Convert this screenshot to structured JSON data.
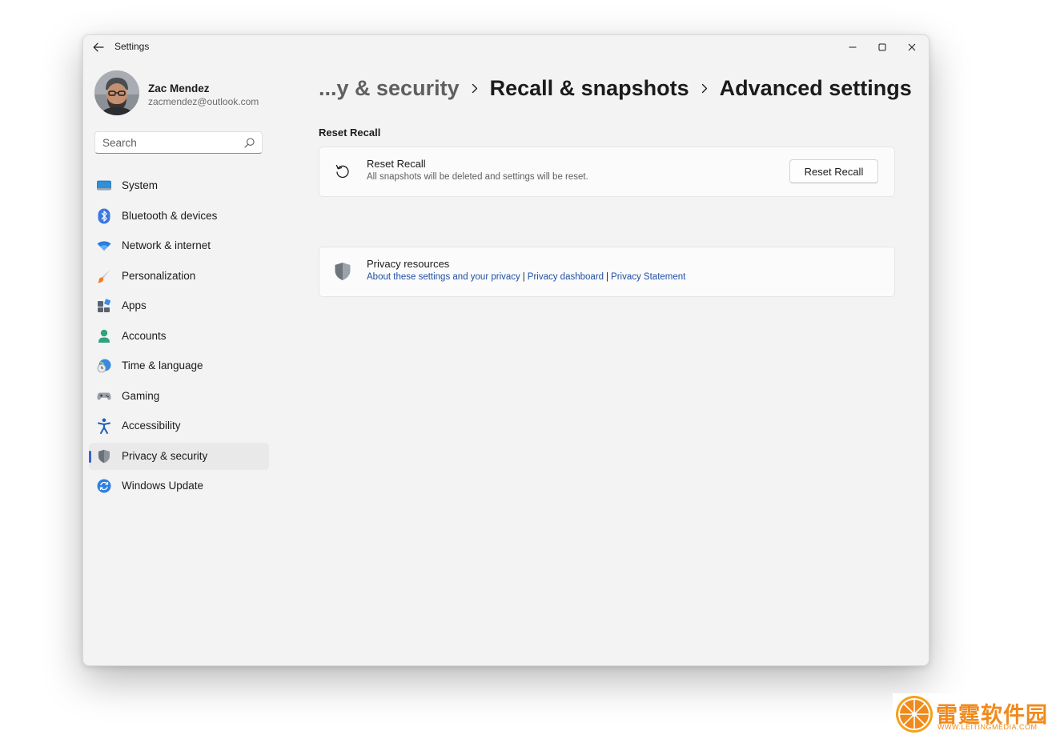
{
  "window": {
    "title": "Settings"
  },
  "profile": {
    "name": "Zac Mendez",
    "email": "zacmendez@outlook.com"
  },
  "search": {
    "placeholder": "Search"
  },
  "sidebar": {
    "items": [
      {
        "label": "System",
        "icon": "system-icon"
      },
      {
        "label": "Bluetooth & devices",
        "icon": "bluetooth-icon"
      },
      {
        "label": "Network & internet",
        "icon": "wifi-icon"
      },
      {
        "label": "Personalization",
        "icon": "brush-icon"
      },
      {
        "label": "Apps",
        "icon": "apps-icon"
      },
      {
        "label": "Accounts",
        "icon": "accounts-icon"
      },
      {
        "label": "Time & language",
        "icon": "globe-clock-icon"
      },
      {
        "label": "Gaming",
        "icon": "gamepad-icon"
      },
      {
        "label": "Accessibility",
        "icon": "accessibility-icon"
      },
      {
        "label": "Privacy & security",
        "icon": "shield-icon",
        "active": true
      },
      {
        "label": "Windows Update",
        "icon": "update-icon"
      }
    ]
  },
  "breadcrumb": {
    "items": [
      "...y & security",
      "Recall & snapshots",
      "Advanced settings"
    ]
  },
  "reset_section": {
    "heading": "Reset Recall",
    "card_title": "Reset Recall",
    "card_description": "All snapshots will be deleted and settings will be reset.",
    "button_label": "Reset Recall"
  },
  "privacy_resources": {
    "title": "Privacy resources",
    "links": [
      "About these settings and your privacy",
      "Privacy dashboard",
      "Privacy Statement"
    ]
  },
  "watermark": {
    "brand": "雷霆软件园",
    "url": "WWW.LEITINGMEDIA.COM"
  },
  "colors": {
    "accent": "#3a62c8",
    "link": "#1f4fa3",
    "window_bg": "#f3f3f3",
    "watermark": "#f08a1c"
  }
}
